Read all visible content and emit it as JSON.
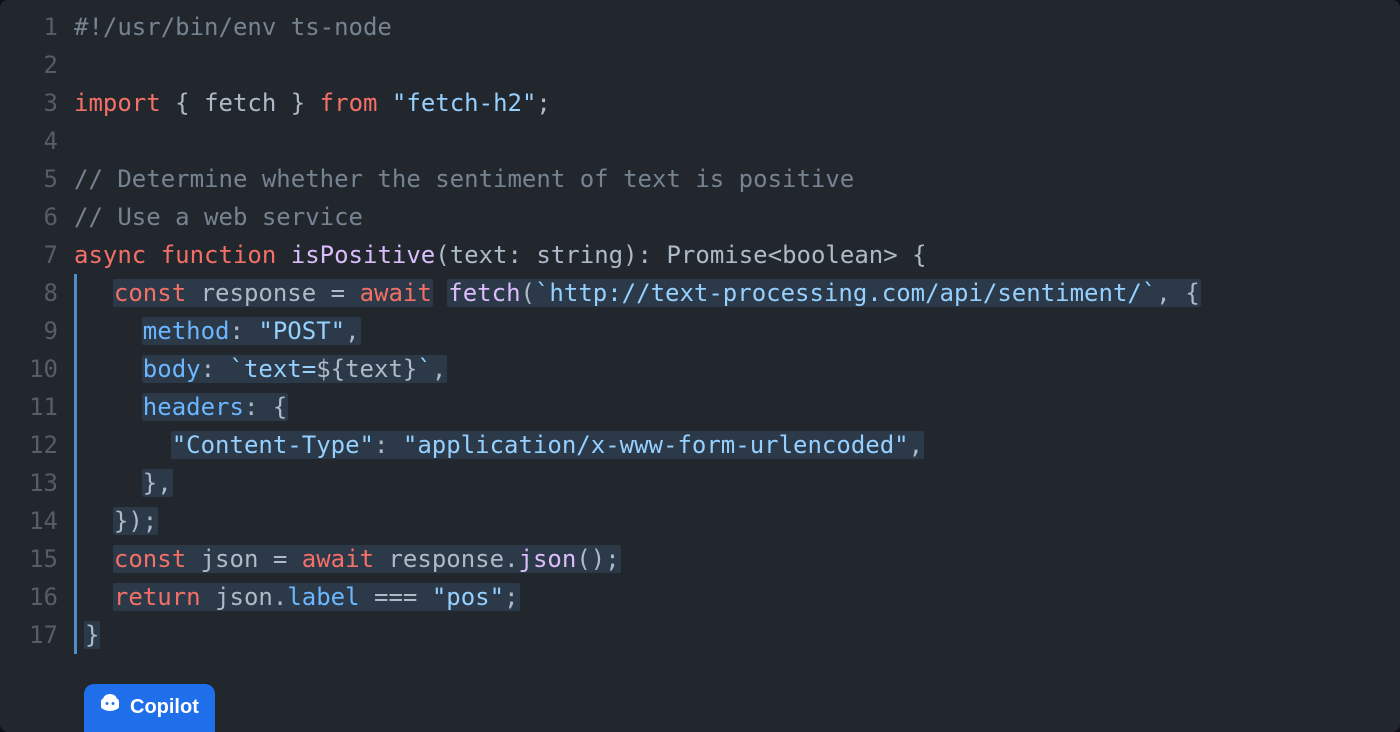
{
  "lines": [
    {
      "n": "1",
      "html": "<span class='cm'>#!/usr/bin/env ts-node</span>",
      "bar": false
    },
    {
      "n": "2",
      "html": "",
      "bar": false
    },
    {
      "n": "3",
      "html": "<span class='kw'>import</span> <span class='pn'>{</span> <span class='id'>fetch</span> <span class='pn'>}</span> <span class='kw'>from</span> <span class='str'>\"fetch-h2\"</span><span class='pn'>;</span>",
      "bar": false
    },
    {
      "n": "4",
      "html": "",
      "bar": false
    },
    {
      "n": "5",
      "html": "<span class='cm'>// Determine whether the sentiment of text is positive</span>",
      "bar": false
    },
    {
      "n": "6",
      "html": "<span class='cm'>// Use a web service</span>",
      "bar": false
    },
    {
      "n": "7",
      "html": "<span class='kw'>async</span> <span class='kw'>function</span> <span class='fn'>isPositive</span><span class='pn'>(</span><span class='id'>text</span><span class='pn'>:</span> <span class='tp'>string</span><span class='pn'>):</span> <span class='tp'>Promise</span><span class='pn'>&lt;</span><span class='tp'>boolean</span><span class='pn'>&gt;</span> <span class='pn'>{</span>",
      "bar": false
    },
    {
      "n": "8",
      "html": "  <span class='suggest'><span class='kw'>const</span> <span class='id'>response</span> <span class='pn'>=</span> <span class='kw'>await</span></span> <span class='suggest'><span class='fn'>fetch</span><span class='pn'>(</span><span class='str'>`http://text-processing.com/api/sentiment/`</span><span class='pn'>, {</span></span>",
      "bar": true
    },
    {
      "n": "9",
      "html": "    <span class='suggest'><span class='prop'>method</span><span class='pn'>:</span> <span class='str'>\"POST\"</span><span class='pn'>,</span></span>",
      "bar": true
    },
    {
      "n": "10",
      "html": "    <span class='suggest'><span class='prop'>body</span><span class='pn'>:</span> <span class='str'>`text=</span><span class='pn'>${</span><span class='id'>text</span><span class='pn'>}</span><span class='str'>`</span><span class='pn'>,</span></span>",
      "bar": true
    },
    {
      "n": "11",
      "html": "    <span class='suggest'><span class='prop'>headers</span><span class='pn'>:</span> <span class='pn'>{</span></span>",
      "bar": true
    },
    {
      "n": "12",
      "html": "      <span class='suggest'><span class='str'>\"Content-Type\"</span><span class='pn'>:</span> <span class='str'>\"application/x-www-form-urlencoded\"</span><span class='pn'>,</span></span>",
      "bar": true
    },
    {
      "n": "13",
      "html": "    <span class='suggest'><span class='pn'>},</span></span>",
      "bar": true
    },
    {
      "n": "14",
      "html": "  <span class='suggest'><span class='pn'>});</span></span>",
      "bar": true
    },
    {
      "n": "15",
      "html": "  <span class='suggest'><span class='kw'>const</span> <span class='id'>json</span> <span class='pn'>=</span> <span class='kw'>await</span> <span class='id'>response</span><span class='pn'>.</span><span class='fn'>json</span><span class='pn'>();</span></span>",
      "bar": true
    },
    {
      "n": "16",
      "html": "  <span class='suggest'><span class='kw'>return</span> <span class='id'>json</span><span class='pn'>.</span><span class='prop'>label</span> <span class='pn'>===</span> <span class='str'>\"pos\"</span><span class='pn'>;</span></span>",
      "bar": true
    },
    {
      "n": "17",
      "html": "<span class='suggest'><span class='pn'>}</span></span>",
      "bar": true
    }
  ],
  "badge": {
    "label": "Copilot"
  }
}
